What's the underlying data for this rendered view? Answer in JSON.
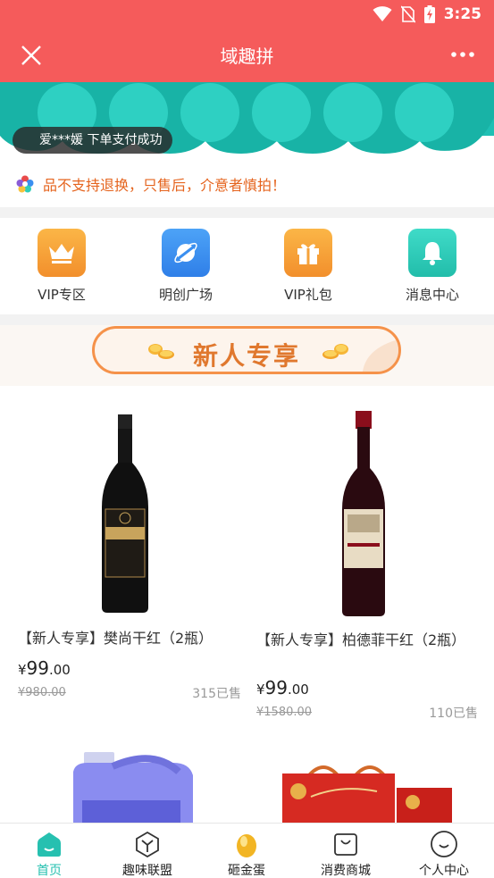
{
  "status_bar": {
    "time": "3:25"
  },
  "header": {
    "title": "域趣拼"
  },
  "banner": {
    "ticker": "爱***媛 下单支付成功"
  },
  "notice": {
    "text": "品不支持退换，只售后，介意者慎拍！"
  },
  "shortcuts": [
    {
      "label": "VIP专区",
      "icon": "crown-icon",
      "color": "#f7a53a"
    },
    {
      "label": "明创广场",
      "icon": "planet-icon",
      "color": "#3a8ff0"
    },
    {
      "label": "VIP礼包",
      "icon": "gift-icon",
      "color": "#f7a53a"
    },
    {
      "label": "消息中心",
      "icon": "bell-icon",
      "color": "#2fcdb9"
    }
  ],
  "newuser": {
    "title": "新人专享"
  },
  "products": [
    {
      "name": "【新人专享】樊尚干红（2瓶）",
      "currency": "¥",
      "price_int": "99",
      "price_dec": ".00",
      "original": "¥980.00",
      "sold": "315已售"
    },
    {
      "name": "【新人专享】柏德菲干红（2瓶）",
      "currency": "¥",
      "price_int": "99",
      "price_dec": ".00",
      "original": "¥1580.00",
      "sold": "110已售"
    }
  ],
  "nav": {
    "items": [
      {
        "label": "首页",
        "icon": "home-icon"
      },
      {
        "label": "趣味联盟",
        "icon": "cube-icon"
      },
      {
        "label": "砸金蛋",
        "icon": "golden-egg-icon"
      },
      {
        "label": "消费商城",
        "icon": "shopping-bag-icon"
      },
      {
        "label": "个人中心",
        "icon": "smile-icon"
      }
    ],
    "active": "首页"
  },
  "colors": {
    "primary": "#f55b5b",
    "accent": "#26c0b0",
    "warning": "#e5641e"
  }
}
